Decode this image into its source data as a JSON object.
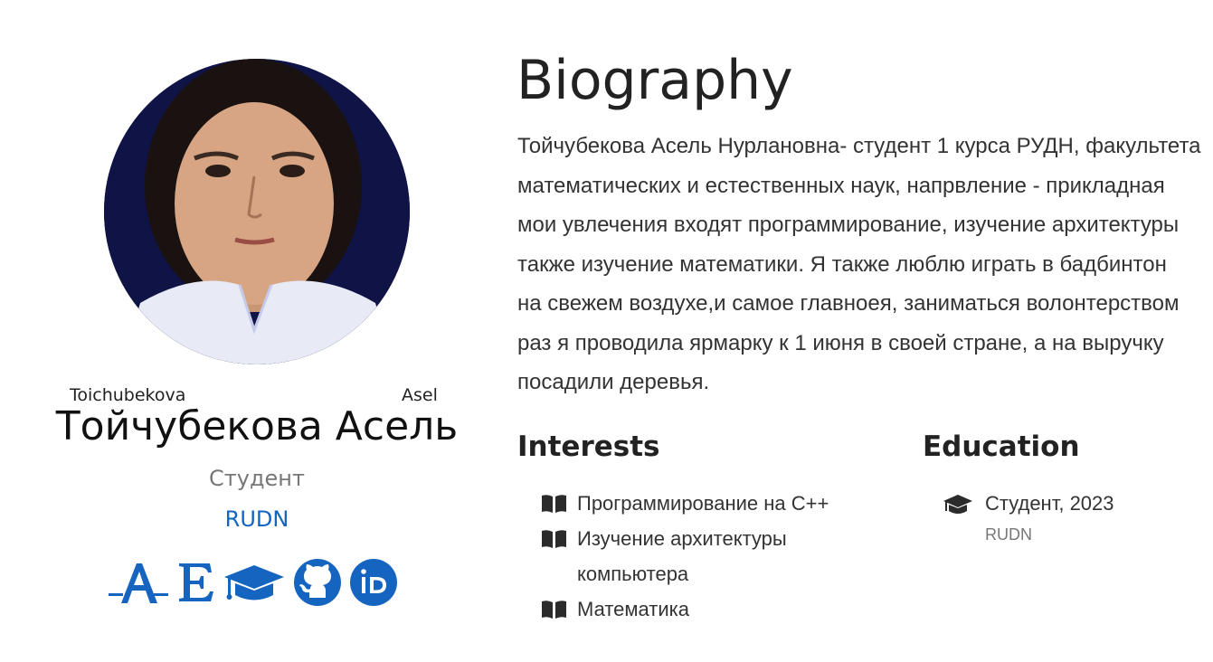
{
  "profile": {
    "name_family_latin": "Toichubekova",
    "name_given_latin": "Asel",
    "name": "Тойчубекова Асель",
    "role": "Студент",
    "organization": "RUDN",
    "social_icons": [
      {
        "name": "academia-icon",
        "label": "-A-"
      },
      {
        "name": "elibrary-icon",
        "label": "E"
      },
      {
        "name": "graduation-cap-icon",
        "label": ""
      },
      {
        "name": "github-icon",
        "label": ""
      },
      {
        "name": "orcid-icon",
        "label": "iD"
      }
    ]
  },
  "biography": {
    "title": "Biography",
    "lines": [
      "Тойчубекова Асель Нурлановна- студент 1 курса РУДН, факультета",
      "математических и естественных наук, напрвление - прикладная",
      "мои увлечения входят программирование, изучение архитектуры",
      "также изучение математики. Я также люблю играть в бадбинтон",
      "на свежем воздухе,и самое главноея, заниматься волонтерством",
      "раз я проводила ярмарку к 1 июня в своей стране, а на выручку",
      "посадили деревья."
    ]
  },
  "interests": {
    "title": "Interests",
    "items": [
      "Программирование на C++",
      "Изучение архитектуры компьютера",
      "Математика"
    ]
  },
  "education": {
    "title": "Education",
    "items": [
      {
        "degree": "Студент, 2023",
        "institution": "RUDN"
      }
    ]
  },
  "colors": {
    "accent": "#1565c0",
    "muted": "#777777",
    "text": "#333333"
  }
}
